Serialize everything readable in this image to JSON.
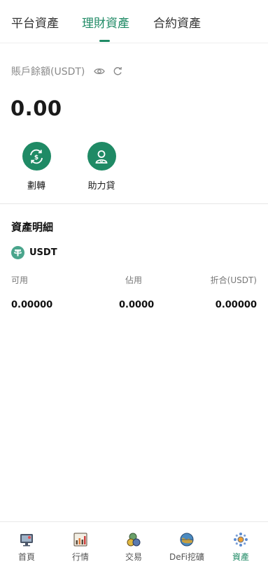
{
  "tabs": [
    {
      "label": "平台資產"
    },
    {
      "label": "理財資產"
    },
    {
      "label": "合約資產"
    }
  ],
  "active_tab": 1,
  "balance": {
    "label": "賬戶餘額(USDT)",
    "value": "0.00"
  },
  "actions": [
    {
      "label": "劃轉",
      "icon": "exchange-icon"
    },
    {
      "label": "助力貸",
      "icon": "loan-person-icon"
    }
  ],
  "details": {
    "title": "資產明細",
    "coin": {
      "name": "USDT",
      "icon": "tether-icon"
    },
    "columns": [
      "可用",
      "佔用",
      "折合(USDT)"
    ],
    "values": [
      "0.00000",
      "0.0000",
      "0.00000"
    ]
  },
  "nav": [
    {
      "label": "首頁",
      "icon": "home-icon"
    },
    {
      "label": "行情",
      "icon": "market-chart-icon"
    },
    {
      "label": "交易",
      "icon": "trade-coins-icon"
    },
    {
      "label": "DeFi挖礦",
      "icon": "defi-globe-icon"
    },
    {
      "label": "資產",
      "icon": "assets-icon"
    }
  ],
  "active_nav": 4,
  "colors": {
    "accent": "#1f8a65",
    "coin": "#4aa58c",
    "muted": "#8a8a8a"
  }
}
